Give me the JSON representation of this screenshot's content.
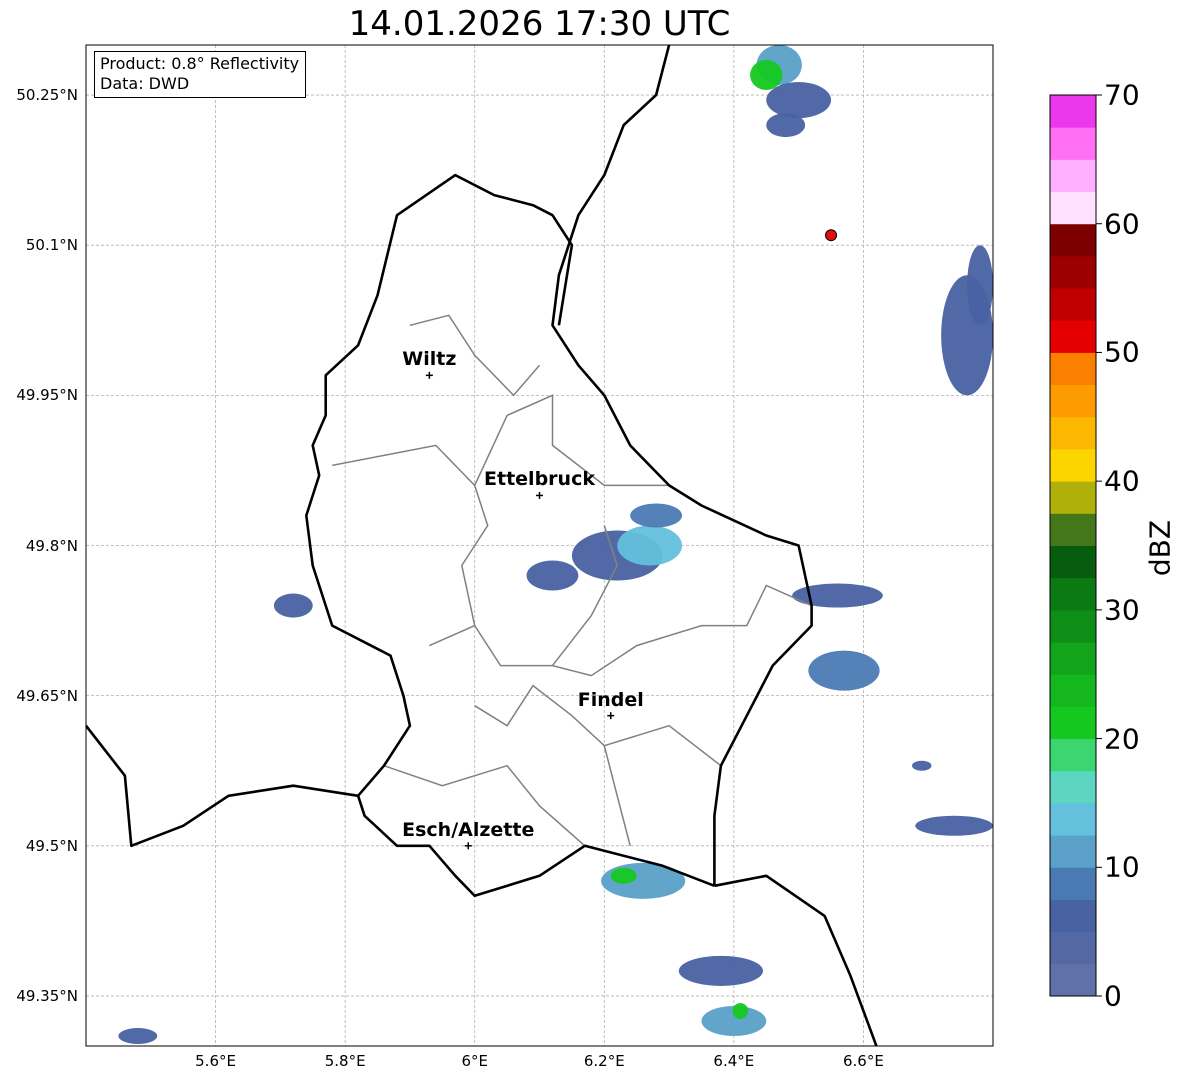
{
  "title": "14.01.2026 17:30 UTC",
  "info": {
    "product": "Product: 0.8° Reflectivity",
    "data": "Data: DWD"
  },
  "axes": {
    "lat_labels": [
      "50.25°N",
      "50.1°N",
      "49.95°N",
      "49.8°N",
      "49.65°N",
      "49.5°N",
      "49.35°N"
    ],
    "lon_labels": [
      "5.6°E",
      "5.8°E",
      "6°E",
      "6.2°E",
      "6.4°E",
      "6.6°E"
    ],
    "lat_values": [
      50.25,
      50.1,
      49.95,
      49.8,
      49.65,
      49.5,
      49.35
    ],
    "lon_values": [
      5.6,
      5.8,
      6.0,
      6.2,
      6.4,
      6.6
    ],
    "extent": {
      "lon_min": 5.4,
      "lon_max": 6.8,
      "lat_min": 49.3,
      "lat_max": 50.3
    }
  },
  "cities": [
    {
      "name": "Wiltz",
      "lon": 5.93,
      "lat": 49.97
    },
    {
      "name": "Ettelbruck",
      "lon": 6.1,
      "lat": 49.85
    },
    {
      "name": "Findel",
      "lon": 6.21,
      "lat": 49.63
    },
    {
      "name": "Esch/Alzette",
      "lon": 5.99,
      "lat": 49.5
    }
  ],
  "radar_site": {
    "lon": 6.55,
    "lat": 50.11,
    "color": "#e01010"
  },
  "colorbar": {
    "label": "dBZ",
    "min": 0,
    "max": 70,
    "step": 2.5,
    "tick_labels": [
      "0",
      "10",
      "20",
      "30",
      "40",
      "50",
      "60",
      "70"
    ],
    "tick_values": [
      0,
      10,
      20,
      30,
      40,
      50,
      60,
      70
    ],
    "colors": [
      "#6070a8",
      "#5468a4",
      "#4862a2",
      "#4a7ab4",
      "#5aa0c8",
      "#64c0dc",
      "#5cd6c0",
      "#3cd670",
      "#14c820",
      "#14b81e",
      "#12a41a",
      "#0e8e16",
      "#0c7a12",
      "#085c0e",
      "#44761a",
      "#b0b00a",
      "#fcd400",
      "#fcb800",
      "#fc9c00",
      "#fc8000",
      "#e40000",
      "#c00000",
      "#9c0000",
      "#7c0000",
      "#ffe0ff",
      "#ffb0ff",
      "#ff70f4",
      "#ec38ec"
    ]
  },
  "reflectivity_cells": [
    {
      "lon": 6.47,
      "lat": 50.28,
      "rx": 0.035,
      "ry": 0.02,
      "dbz": 10
    },
    {
      "lon": 6.45,
      "lat": 50.27,
      "rx": 0.025,
      "ry": 0.015,
      "dbz": 22
    },
    {
      "lon": 6.5,
      "lat": 50.245,
      "rx": 0.05,
      "ry": 0.018,
      "dbz": 7
    },
    {
      "lon": 6.48,
      "lat": 50.22,
      "rx": 0.03,
      "ry": 0.012,
      "dbz": 5
    },
    {
      "lon": 6.76,
      "lat": 50.01,
      "rx": 0.04,
      "ry": 0.06,
      "dbz": 7
    },
    {
      "lon": 6.78,
      "lat": 50.06,
      "rx": 0.02,
      "ry": 0.04,
      "dbz": 5
    },
    {
      "lon": 6.22,
      "lat": 49.79,
      "rx": 0.07,
      "ry": 0.025,
      "dbz": 7
    },
    {
      "lon": 6.27,
      "lat": 49.8,
      "rx": 0.05,
      "ry": 0.02,
      "dbz": 13
    },
    {
      "lon": 6.12,
      "lat": 49.77,
      "rx": 0.04,
      "ry": 0.015,
      "dbz": 6
    },
    {
      "lon": 6.28,
      "lat": 49.83,
      "rx": 0.04,
      "ry": 0.012,
      "dbz": 8
    },
    {
      "lon": 6.56,
      "lat": 49.75,
      "rx": 0.07,
      "ry": 0.012,
      "dbz": 7
    },
    {
      "lon": 6.57,
      "lat": 49.675,
      "rx": 0.055,
      "ry": 0.02,
      "dbz": 8
    },
    {
      "lon": 6.26,
      "lat": 49.465,
      "rx": 0.065,
      "ry": 0.018,
      "dbz": 10
    },
    {
      "lon": 6.23,
      "lat": 49.47,
      "rx": 0.02,
      "ry": 0.008,
      "dbz": 20
    },
    {
      "lon": 6.38,
      "lat": 49.375,
      "rx": 0.065,
      "ry": 0.015,
      "dbz": 7
    },
    {
      "lon": 6.4,
      "lat": 49.325,
      "rx": 0.05,
      "ry": 0.015,
      "dbz": 12
    },
    {
      "lon": 6.41,
      "lat": 49.335,
      "rx": 0.012,
      "ry": 0.008,
      "dbz": 22
    },
    {
      "lon": 6.74,
      "lat": 49.52,
      "rx": 0.06,
      "ry": 0.01,
      "dbz": 7
    },
    {
      "lon": 5.72,
      "lat": 49.74,
      "rx": 0.03,
      "ry": 0.012,
      "dbz": 6
    },
    {
      "lon": 5.48,
      "lat": 49.31,
      "rx": 0.03,
      "ry": 0.008,
      "dbz": 7
    },
    {
      "lon": 6.69,
      "lat": 49.58,
      "rx": 0.015,
      "ry": 0.005,
      "dbz": 6
    }
  ],
  "borders": {
    "country": [
      [
        [
          6.3,
          50.3
        ],
        [
          6.28,
          50.25
        ],
        [
          6.23,
          50.22
        ],
        [
          6.2,
          50.17
        ],
        [
          6.16,
          50.13
        ],
        [
          6.13,
          50.07
        ],
        [
          6.12,
          50.02
        ],
        [
          6.16,
          49.98
        ],
        [
          6.2,
          49.95
        ],
        [
          6.24,
          49.9
        ],
        [
          6.3,
          49.86
        ],
        [
          6.35,
          49.84
        ],
        [
          6.45,
          49.81
        ],
        [
          6.5,
          49.8
        ],
        [
          6.52,
          49.74
        ],
        [
          6.52,
          49.72
        ],
        [
          6.46,
          49.68
        ],
        [
          6.42,
          49.63
        ],
        [
          6.38,
          49.58
        ],
        [
          6.37,
          49.53
        ],
        [
          6.37,
          49.46
        ]
      ],
      [
        [
          6.37,
          49.46
        ],
        [
          6.29,
          49.48
        ],
        [
          6.17,
          49.5
        ],
        [
          6.1,
          49.47
        ],
        [
          6.0,
          49.45
        ],
        [
          5.97,
          49.47
        ],
        [
          5.93,
          49.5
        ],
        [
          5.88,
          49.5
        ],
        [
          5.83,
          49.53
        ],
        [
          5.82,
          49.55
        ]
      ],
      [
        [
          5.82,
          49.55
        ],
        [
          5.86,
          49.58
        ],
        [
          5.9,
          49.62
        ],
        [
          5.89,
          49.65
        ],
        [
          5.87,
          49.69
        ],
        [
          5.78,
          49.72
        ],
        [
          5.75,
          49.78
        ],
        [
          5.74,
          49.83
        ],
        [
          5.76,
          49.87
        ],
        [
          5.75,
          49.9
        ],
        [
          5.77,
          49.93
        ],
        [
          5.77,
          49.97
        ],
        [
          5.82,
          50.0
        ],
        [
          5.85,
          50.05
        ],
        [
          5.88,
          50.13
        ],
        [
          5.97,
          50.17
        ],
        [
          6.03,
          50.15
        ],
        [
          6.09,
          50.14
        ],
        [
          6.12,
          50.13
        ],
        [
          6.15,
          50.1
        ],
        [
          6.14,
          50.06
        ],
        [
          6.13,
          50.02
        ]
      ],
      [
        [
          5.4,
          49.62
        ],
        [
          5.46,
          49.57
        ],
        [
          5.47,
          49.5
        ],
        [
          5.55,
          49.52
        ],
        [
          5.62,
          49.55
        ],
        [
          5.72,
          49.56
        ],
        [
          5.82,
          49.55
        ]
      ],
      [
        [
          6.37,
          49.46
        ],
        [
          6.45,
          49.47
        ],
        [
          6.54,
          49.43
        ],
        [
          6.58,
          49.37
        ],
        [
          6.62,
          49.3
        ]
      ]
    ],
    "canton": [
      [
        [
          5.9,
          50.02
        ],
        [
          5.96,
          50.03
        ],
        [
          6.0,
          49.99
        ],
        [
          6.06,
          49.95
        ],
        [
          6.1,
          49.98
        ]
      ],
      [
        [
          5.78,
          49.88
        ],
        [
          5.86,
          49.89
        ],
        [
          5.94,
          49.9
        ],
        [
          6.0,
          49.86
        ],
        [
          6.05,
          49.93
        ]
      ],
      [
        [
          6.05,
          49.93
        ],
        [
          6.12,
          49.95
        ],
        [
          6.12,
          49.9
        ],
        [
          6.2,
          49.86
        ],
        [
          6.3,
          49.86
        ]
      ],
      [
        [
          6.0,
          49.86
        ],
        [
          6.02,
          49.82
        ],
        [
          5.98,
          49.78
        ],
        [
          6.0,
          49.72
        ],
        [
          5.93,
          49.7
        ]
      ],
      [
        [
          6.0,
          49.72
        ],
        [
          6.04,
          49.68
        ],
        [
          6.12,
          49.68
        ],
        [
          6.18,
          49.67
        ],
        [
          6.25,
          49.7
        ],
        [
          6.35,
          49.72
        ],
        [
          6.42,
          49.72
        ],
        [
          6.45,
          49.76
        ],
        [
          6.52,
          49.74
        ]
      ],
      [
        [
          6.0,
          49.64
        ],
        [
          6.05,
          49.62
        ],
        [
          6.09,
          49.66
        ],
        [
          6.15,
          49.63
        ],
        [
          6.2,
          49.6
        ],
        [
          6.3,
          49.62
        ],
        [
          6.38,
          49.58
        ]
      ],
      [
        [
          5.86,
          49.58
        ],
        [
          5.95,
          49.56
        ],
        [
          6.05,
          49.58
        ],
        [
          6.1,
          49.54
        ],
        [
          6.17,
          49.5
        ]
      ],
      [
        [
          6.2,
          49.6
        ],
        [
          6.22,
          49.55
        ],
        [
          6.24,
          49.5
        ]
      ],
      [
        [
          6.12,
          49.68
        ],
        [
          6.18,
          49.73
        ],
        [
          6.22,
          49.78
        ],
        [
          6.2,
          49.82
        ]
      ]
    ]
  }
}
